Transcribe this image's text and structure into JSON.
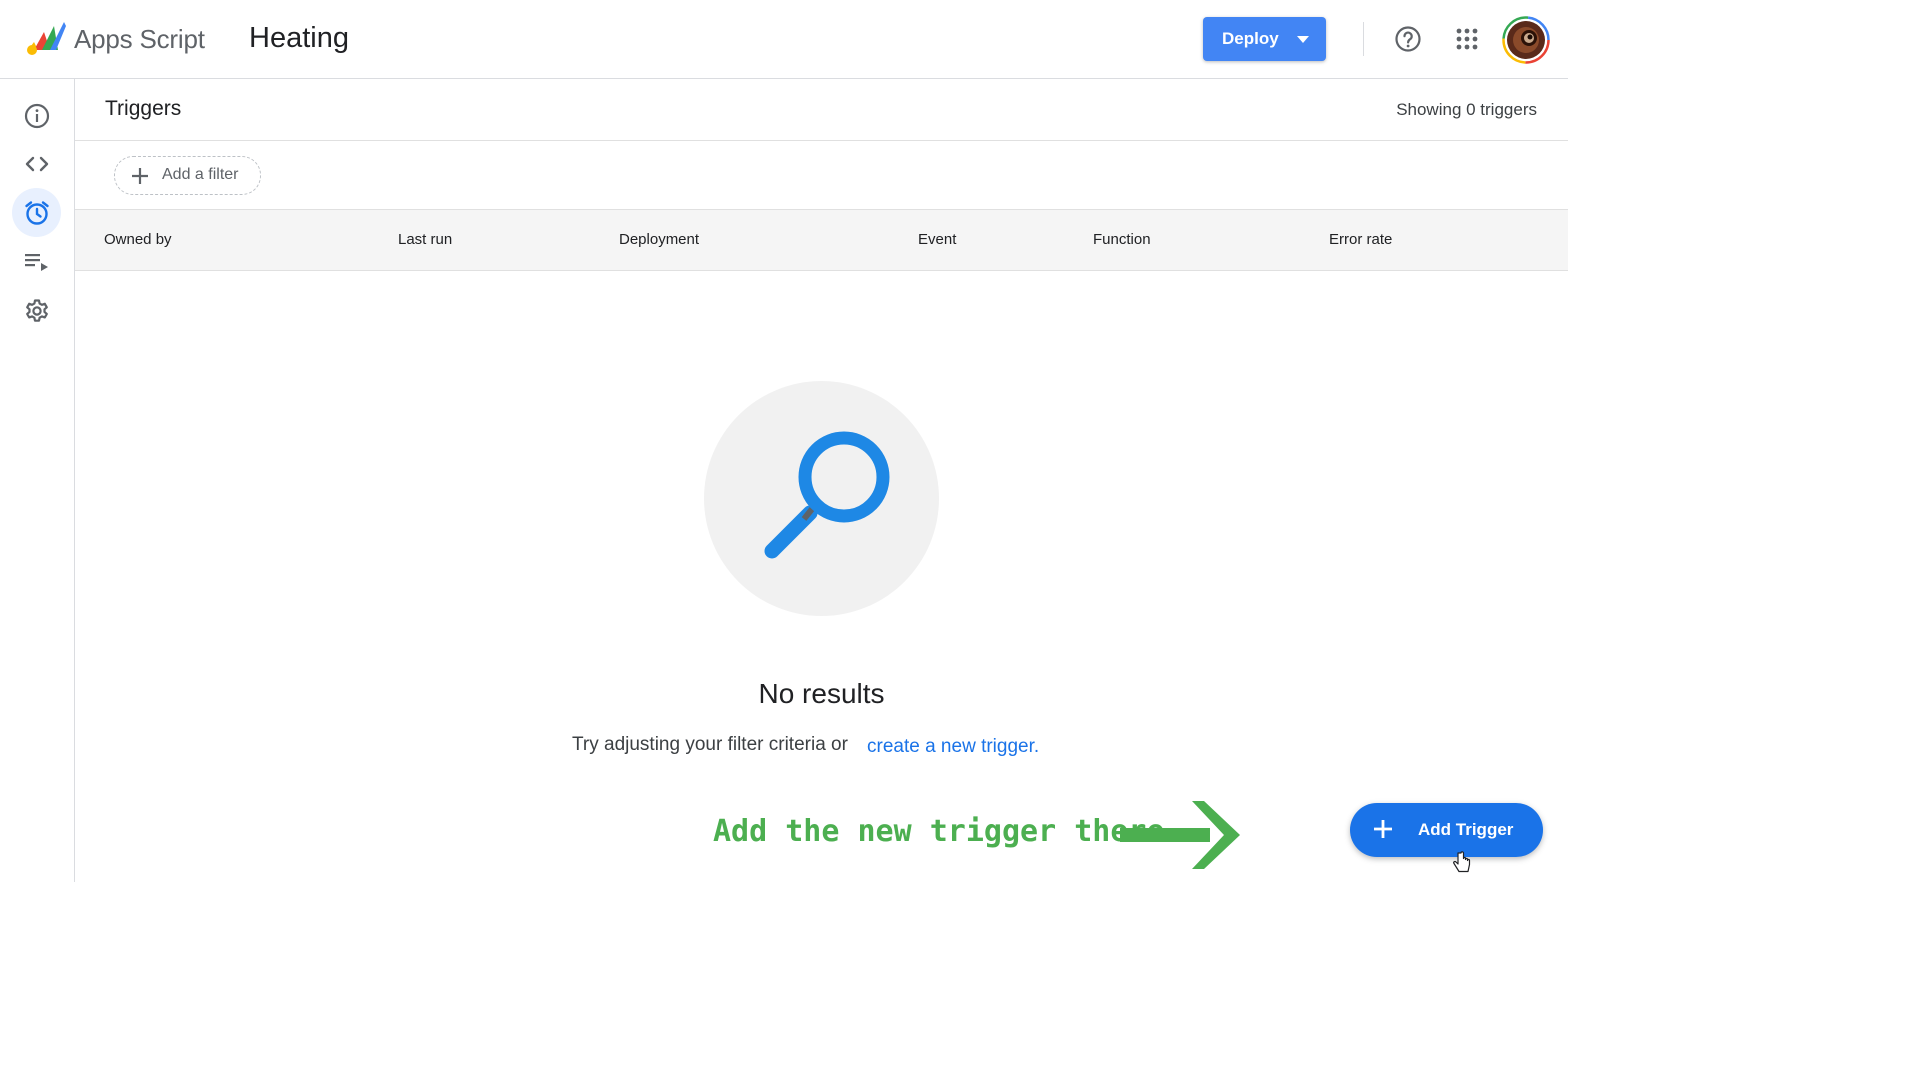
{
  "header": {
    "app_name": "Apps Script",
    "project_name": "Heating",
    "deploy_label": "Deploy",
    "icons": {
      "logo": "apps-script-logo",
      "help": "help-icon",
      "apps": "apps-grid-icon",
      "avatar": "user-avatar"
    }
  },
  "sidebar": {
    "items": [
      {
        "name": "overview",
        "icon": "info-icon",
        "active": false
      },
      {
        "name": "editor",
        "icon": "code-icon",
        "active": false
      },
      {
        "name": "triggers",
        "icon": "alarm-clock-icon",
        "active": true
      },
      {
        "name": "executions",
        "icon": "playlist-play-icon",
        "active": false
      },
      {
        "name": "settings",
        "icon": "gear-icon",
        "active": false
      }
    ]
  },
  "main": {
    "title": "Triggers",
    "showing": "Showing 0 triggers",
    "filter_label": "Add a filter",
    "columns": [
      "Owned by",
      "Last run",
      "Deployment",
      "Event",
      "Function",
      "Error rate"
    ],
    "empty_title": "No results",
    "empty_hint": "Try adjusting your filter criteria or",
    "empty_link": "create a new trigger.",
    "add_trigger_label": "Add Trigger"
  },
  "annotation": {
    "text": "Add the new trigger there",
    "color": "#4caf50"
  },
  "colors": {
    "primary": "#1a73e8",
    "deploy": "#4285f4",
    "active_bg": "#e8f0fe"
  }
}
